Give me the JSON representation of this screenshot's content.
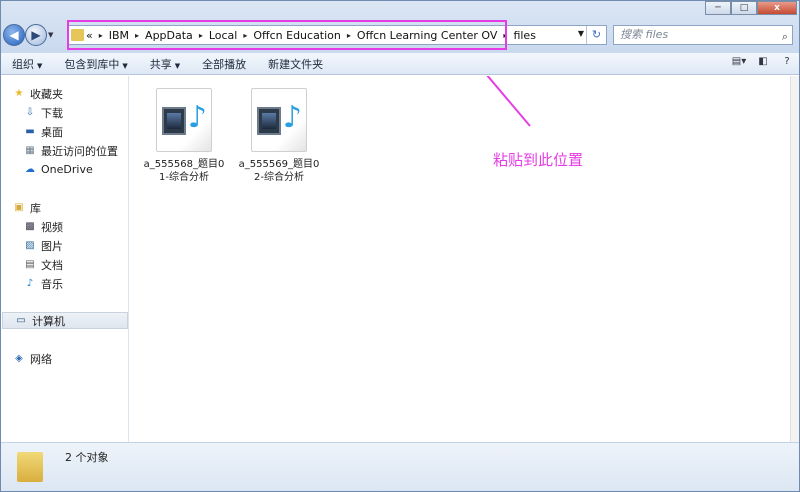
{
  "window": {
    "minimize": "─",
    "maximize": "□",
    "close": "x"
  },
  "address": {
    "overflow": "«",
    "segments": [
      "IBM",
      "AppData",
      "Local",
      "Offcn Education",
      "Offcn Learning Center OV",
      "files"
    ],
    "separator": "▸"
  },
  "search": {
    "placeholder": "搜索 files"
  },
  "toolbar": {
    "organize": "组织",
    "include_in_library": "包含到库中",
    "share": "共享",
    "play_all": "全部播放",
    "new_folder": "新建文件夹"
  },
  "nav": {
    "favorites": "收藏夹",
    "downloads": "下载",
    "desktop": "桌面",
    "recent": "最近访问的位置",
    "onedrive": "OneDrive",
    "libraries": "库",
    "videos": "视频",
    "pictures": "图片",
    "documents": "文档",
    "music": "音乐",
    "computer": "计算机",
    "network": "网络"
  },
  "files": [
    {
      "name": "a_555568_题目01-综合分析"
    },
    {
      "name": "a_555569_题目02-综合分析"
    }
  ],
  "annotation": {
    "text": "粘贴到此位置",
    "color": "#e63ce6"
  },
  "status": {
    "count": "2 个对象"
  }
}
